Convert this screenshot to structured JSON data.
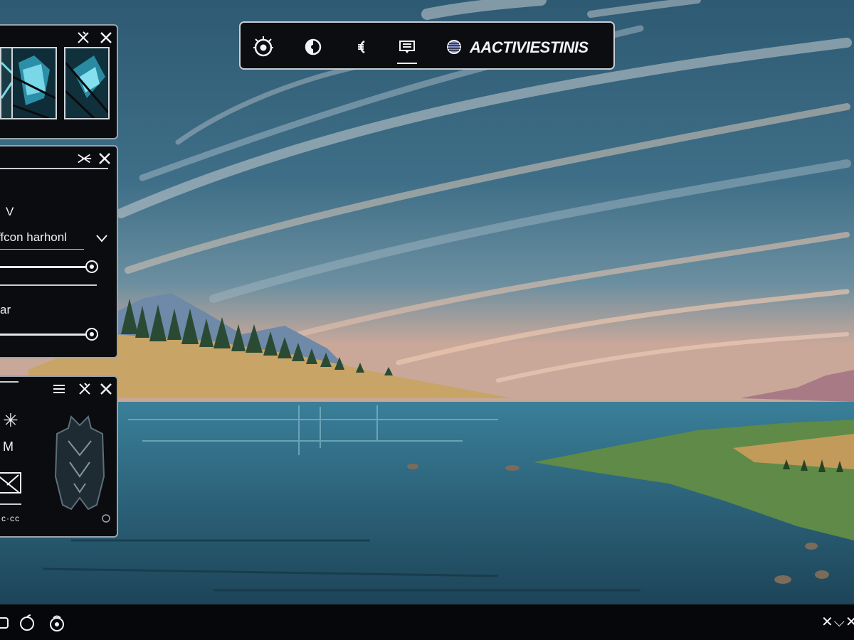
{
  "toolbar": {
    "title": "AACTIVIESTINIS",
    "buttons": [
      {
        "icon": "eye-target-icon"
      },
      {
        "icon": "view-toggle-icon"
      },
      {
        "icon": "layers-icon"
      },
      {
        "icon": "message-icon",
        "active": true
      },
      {
        "icon": "globe-icon"
      }
    ]
  },
  "panel_gallery": {
    "controls": [
      "pin-icon",
      "close-icon"
    ]
  },
  "panel_settings": {
    "fields": [
      {
        "label": "V"
      },
      {
        "value": "ffcon harhonl"
      }
    ],
    "slider_1": {
      "level": 1.0
    },
    "slider_2_label": "ar",
    "slider_2": {
      "level": 1.0
    }
  },
  "panel_profile": {
    "symbol": "✳",
    "label": "M",
    "footer": "c·cc"
  },
  "taskbar": {
    "close_glyph": "✕⌵✕"
  },
  "colors": {
    "panel_bg": "#0b0c0f",
    "panel_border": "#9aa3ab",
    "text": "#eef1f4",
    "sky": "#3d6b85",
    "water": "#2f6e88"
  }
}
